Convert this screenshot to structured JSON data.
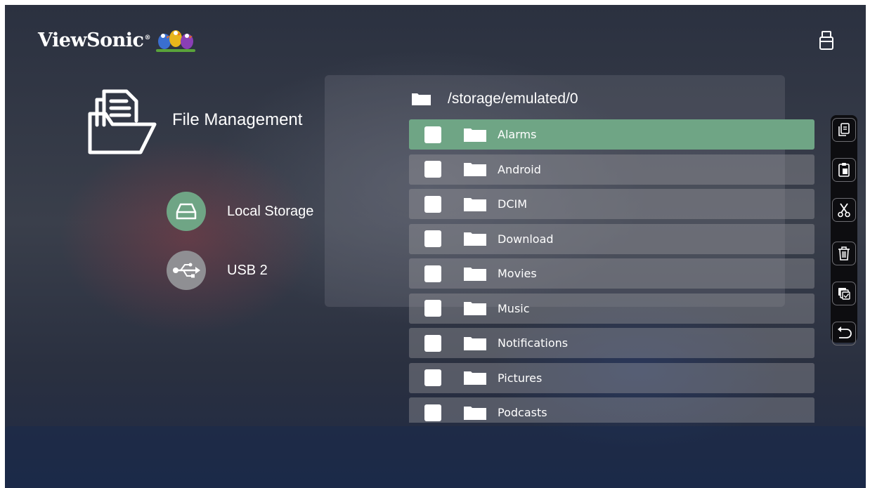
{
  "brand": {
    "name": "ViewSonic",
    "reg": "®"
  },
  "header": {
    "usb_icon": "usb-stick-icon"
  },
  "left_panel": {
    "title": "File Management",
    "sources": [
      {
        "label": "Local Storage",
        "icon": "hard-drive-icon",
        "active": true
      },
      {
        "label": "USB 2",
        "icon": "usb-symbol-icon",
        "active": false
      }
    ]
  },
  "path": {
    "text": "/storage/emulated/0"
  },
  "files": [
    {
      "name": "Alarms",
      "selected": true
    },
    {
      "name": "Android",
      "selected": false
    },
    {
      "name": "DCIM",
      "selected": false
    },
    {
      "name": "Download",
      "selected": false
    },
    {
      "name": "Movies",
      "selected": false
    },
    {
      "name": "Music",
      "selected": false
    },
    {
      "name": "Notifications",
      "selected": false
    },
    {
      "name": "Pictures",
      "selected": false
    },
    {
      "name": "Podcasts",
      "selected": false
    }
  ],
  "toolbar": [
    "copy-icon",
    "paste-icon",
    "cut-icon",
    "delete-icon",
    "select-all-icon",
    "back-icon"
  ],
  "colors": {
    "accent": "#6fa585",
    "active_source": "#6fa585",
    "inactive_source": "#8f8f93",
    "toolbar_bg": "#0d0d10"
  }
}
